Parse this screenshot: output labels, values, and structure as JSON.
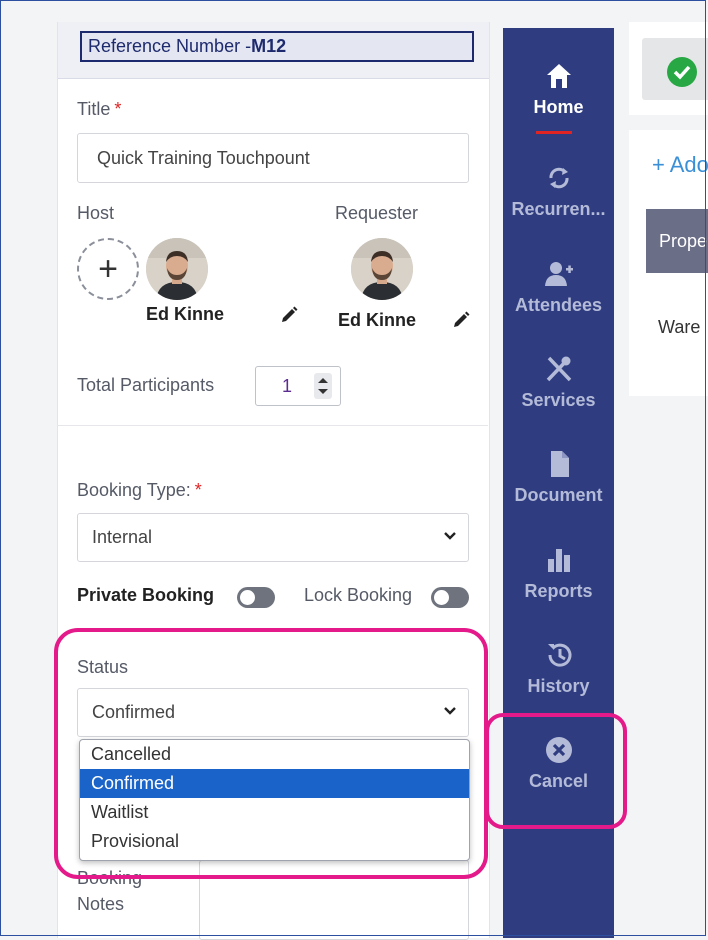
{
  "reference": {
    "prefix": "Reference Number -",
    "code": "M12"
  },
  "form": {
    "title_label": "Title",
    "required_mark": "*",
    "title_value": "Quick Training Touchpount",
    "host_label": "Host",
    "requester_label": "Requester",
    "host_name": "Ed Kinne",
    "requester_name": "Ed Kinne",
    "participants_label": "Total Participants",
    "participants_value": "1",
    "booking_type_label": "Booking Type:",
    "booking_type_value": "Internal",
    "private_booking_label": "Private Booking",
    "lock_booking_label": "Lock Booking",
    "status_label": "Status",
    "status_value": "Confirmed",
    "status_options": [
      "Cancelled",
      "Confirmed",
      "Waitlist",
      "Provisional"
    ],
    "notes_label_line1": "Booking",
    "notes_label_line2": "Notes"
  },
  "sidebar": {
    "items": [
      {
        "label": "Home",
        "icon": "home-icon"
      },
      {
        "label": "Recurren...",
        "icon": "recurrence-icon"
      },
      {
        "label": "Attendees",
        "icon": "add-user-icon"
      },
      {
        "label": "Services",
        "icon": "utensils-icon"
      },
      {
        "label": "Document",
        "icon": "document-icon"
      },
      {
        "label": "Reports",
        "icon": "bar-chart-icon"
      },
      {
        "label": "History",
        "icon": "history-icon"
      },
      {
        "label": "Cancel",
        "icon": "cancel-icon"
      }
    ]
  },
  "right": {
    "add_link": "+ Ado",
    "column_header": "Prope",
    "row_text": "Ware"
  },
  "colors": {
    "sidebar_bg": "#2f3d80",
    "highlight": "#e4198a",
    "selected_option": "#1a63c9",
    "success": "#27a844"
  }
}
